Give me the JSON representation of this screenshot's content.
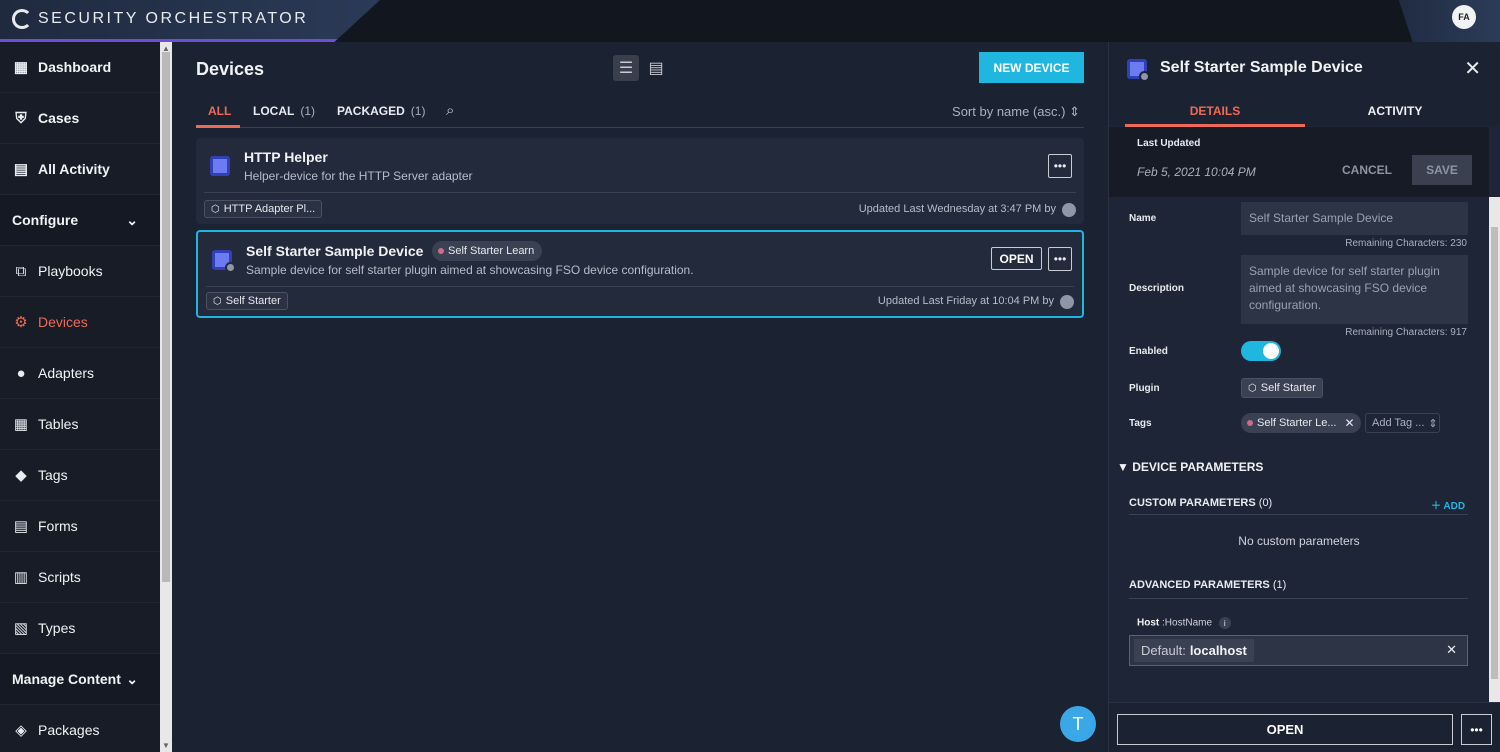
{
  "app": {
    "title": "SECURITY ORCHESTRATOR",
    "user_initials": "FA"
  },
  "sidebar": {
    "items": [
      {
        "label": "Dashboard",
        "icon": "grid-icon"
      },
      {
        "label": "Cases",
        "icon": "shield-check-icon"
      },
      {
        "label": "All Activity",
        "icon": "activity-chart-icon"
      },
      {
        "label": "Configure",
        "section": true
      },
      {
        "label": "Playbooks",
        "icon": "playbooks-icon"
      },
      {
        "label": "Devices",
        "icon": "chip-icon",
        "active": true
      },
      {
        "label": "Adapters",
        "icon": "adapter-icon"
      },
      {
        "label": "Tables",
        "icon": "table-icon"
      },
      {
        "label": "Tags",
        "icon": "tag-icon"
      },
      {
        "label": "Forms",
        "icon": "form-icon"
      },
      {
        "label": "Scripts",
        "icon": "script-icon"
      },
      {
        "label": "Types",
        "icon": "types-icon"
      },
      {
        "label": "Manage Content",
        "section": true
      },
      {
        "label": "Packages",
        "icon": "package-icon"
      }
    ]
  },
  "main": {
    "title": "Devices",
    "new_button": "NEW DEVICE",
    "tabs": [
      {
        "label": "ALL",
        "count": ""
      },
      {
        "label": "LOCAL",
        "count": "(1)"
      },
      {
        "label": "PACKAGED",
        "count": "(1)"
      }
    ],
    "sort_label": "Sort by name (asc.)",
    "devices": [
      {
        "name": "HTTP Helper",
        "description": "Helper-device for the HTTP Server adapter",
        "plugin": "HTTP Adapter Pl...",
        "updated": "Updated Last Wednesday at 3:47 PM by"
      },
      {
        "name": "Self Starter Sample Device",
        "tag": "Self Starter Learn",
        "description": "Sample device for self starter plugin aimed at showcasing FSO device configuration.",
        "plugin": "Self Starter",
        "updated": "Updated Last Friday at 10:04 PM by",
        "open_label": "OPEN"
      }
    ],
    "fab_label": "T"
  },
  "panel": {
    "title": "Self Starter Sample Device",
    "tabs": [
      "DETAILS",
      "ACTIVITY"
    ],
    "last_updated_label": "Last Updated",
    "last_updated_value": "Feb 5, 2021 10:04 PM",
    "cancel_label": "CANCEL",
    "save_label": "SAVE",
    "name_label": "Name",
    "name_value": "Self Starter Sample Device",
    "name_remaining": "Remaining Characters: 230",
    "description_label": "Description",
    "description_value": "Sample device for self starter plugin aimed at showcasing FSO device configuration.",
    "description_remaining": "Remaining Characters: 917",
    "enabled_label": "Enabled",
    "enabled": true,
    "plugin_label": "Plugin",
    "plugin_value": "Self Starter",
    "tags_label": "Tags",
    "tag_value": "Self Starter Le...",
    "add_tag_placeholder": "Add Tag ...",
    "device_params_label": "DEVICE PARAMETERS",
    "custom_params_label": "CUSTOM PARAMETERS",
    "custom_params_count": "(0)",
    "add_label": "ADD",
    "no_custom_params": "No custom parameters",
    "advanced_params_label": "ADVANCED PARAMETERS",
    "advanced_params_count": "(1)",
    "host_label": "Host",
    "host_type": ":HostName",
    "host_default_prefix": "Default:",
    "host_default_value": "localhost",
    "open_label": "OPEN"
  },
  "colors": {
    "accent": "#1fb6e0",
    "active": "#ef6a55",
    "background": "#1b2232"
  }
}
